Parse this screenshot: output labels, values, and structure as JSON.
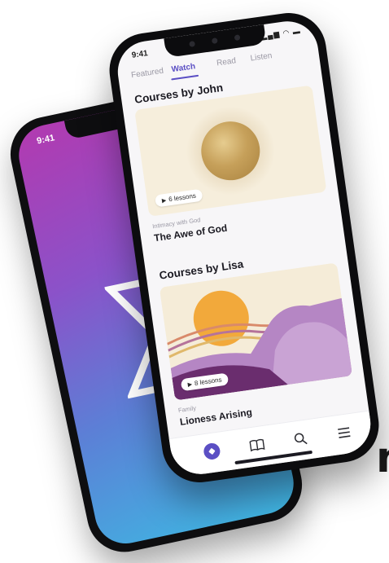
{
  "partial_text": "n",
  "back_phone": {
    "time": "9:41"
  },
  "front_phone": {
    "status": {
      "time": "9:41",
      "icons": "▂▄▆ ◠ ▬"
    },
    "tabs": [
      {
        "label": "Featured",
        "active": false
      },
      {
        "label": "Watch",
        "active": true
      },
      {
        "label": "Read",
        "active": false
      },
      {
        "label": "Listen",
        "active": false
      }
    ],
    "sections": [
      {
        "title": "Courses by John",
        "lessons": "6 lessons",
        "category": "Intimacy with God",
        "course_title": "The Awe of God"
      },
      {
        "title": "Courses by Lisa",
        "lessons": "8 lessons",
        "category": "Family",
        "course_title": "Lioness Arising"
      }
    ],
    "bottom_nav": [
      {
        "name": "compass-icon",
        "active": true
      },
      {
        "name": "book-icon",
        "active": false
      },
      {
        "name": "search-icon",
        "active": false
      },
      {
        "name": "menu-icon",
        "active": false
      }
    ]
  },
  "colors": {
    "accent": "#5b4fc4",
    "gradient_top": "#b23ab0",
    "gradient_bottom": "#3fb6e2",
    "sun_gold": "#c6a05a",
    "lisa_orange": "#f2a93b",
    "lisa_purple": "#6a2d6e"
  }
}
